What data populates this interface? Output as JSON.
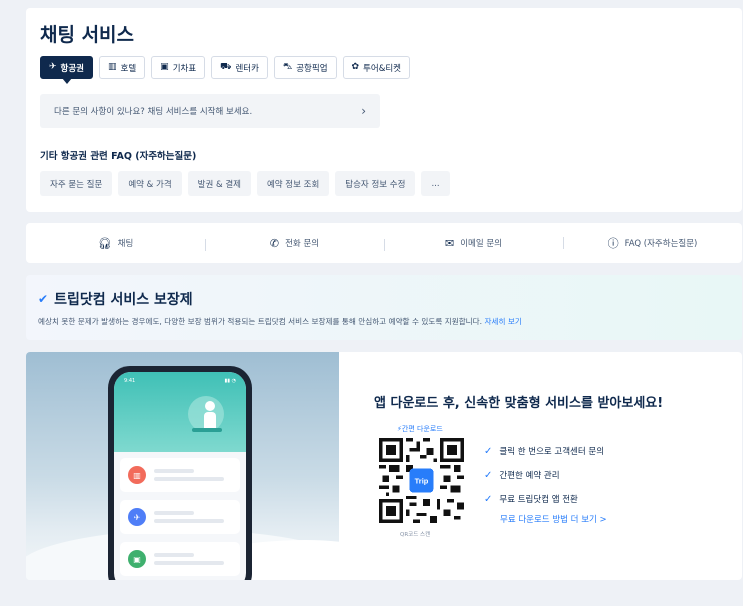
{
  "chat": {
    "title": "채팅 서비스",
    "tabs": [
      {
        "label": "항공권",
        "icon": "plane-icon",
        "active": true
      },
      {
        "label": "호텔",
        "icon": "hotel-icon",
        "active": false
      },
      {
        "label": "기차표",
        "icon": "train-icon",
        "active": false
      },
      {
        "label": "렌터카",
        "icon": "car-icon",
        "active": false
      },
      {
        "label": "공항픽업",
        "icon": "pickup-icon",
        "active": false
      },
      {
        "label": "투어&티켓",
        "icon": "ticket-icon",
        "active": false
      }
    ],
    "prompt": "다른 문의 사항이 있나요? 채팅 서비스를 시작해 보세요.",
    "faq_title": "기타 항공권 관련 FAQ (자주하는질문)",
    "faq_chips": [
      "자주 묻는 질문",
      "예약 & 가격",
      "발권 & 결제",
      "예약 정보 조회",
      "탑승자 정보 수정",
      "..."
    ]
  },
  "contact": {
    "items": [
      {
        "label": "채팅",
        "icon": "headset-icon"
      },
      {
        "label": "전화 문의",
        "icon": "phone-icon"
      },
      {
        "label": "이메일 문의",
        "icon": "mail-icon"
      },
      {
        "label": "FAQ (자주하는질문)",
        "icon": "info-icon"
      }
    ]
  },
  "guarantee": {
    "title": "트립닷컴 서비스 보장제",
    "desc": "예상치 못한 문제가 발생하는 경우에도, 다양한 보장 범위가 적용되는 트립닷컴 서비스 보장제를 통해 안심하고 예약할 수 있도록 지원합니다.",
    "link": "자세히 보기"
  },
  "app": {
    "title": "앱 다운로드 후, 신속한 맞춤형 서비스를 받아보세요!",
    "quick_download": "간편 다운로드",
    "qr_caption": "QR코드 스캔",
    "qr_badge": "Trip",
    "features": [
      "클릭 한 번으로 고객센터 문의",
      "간편한 예약 관리",
      "무료 트립닷컴 앱 전환"
    ],
    "more_link": "무료 다운로드 방법 더 보기 >",
    "phone_status_time": "9:41"
  },
  "colors": {
    "navy": "#0f294d",
    "accent": "#287dfa",
    "background": "#eef1f6"
  }
}
